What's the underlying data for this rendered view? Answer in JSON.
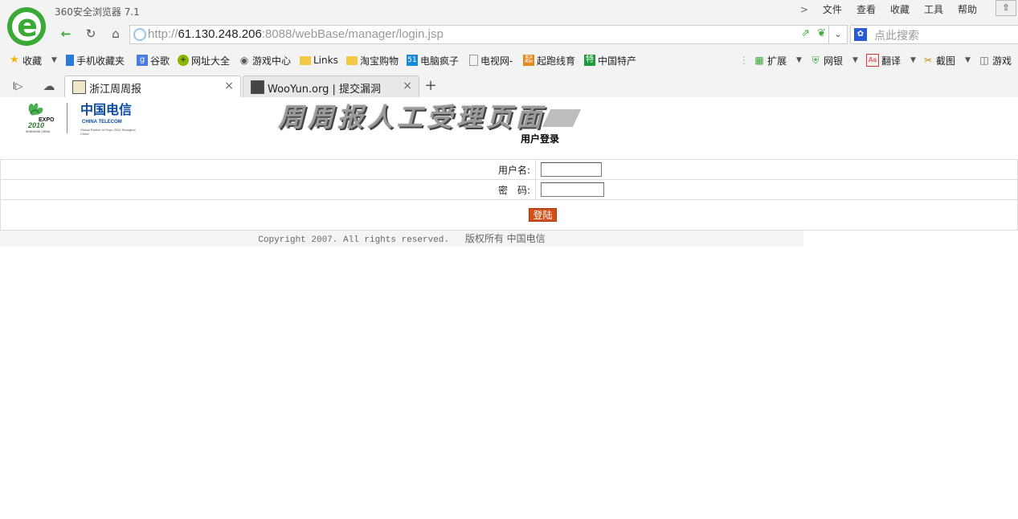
{
  "app": {
    "title": "360安全浏览器 7.1"
  },
  "menu": {
    "chevron": ">",
    "items": [
      "文件",
      "查看",
      "收藏",
      "工具",
      "帮助"
    ],
    "up": "⇧"
  },
  "toolbar": {
    "back": "←",
    "reload": "↻",
    "home": "⌂"
  },
  "address": {
    "url_prefix": "http://",
    "url_host": "61.130.248.206",
    "url_rest": ":8088/webBase/manager/login.jsp",
    "dropdown": "⌄"
  },
  "search": {
    "placeholder": "点此搜索"
  },
  "bookmarks": [
    {
      "label": "收藏",
      "icon": "star-icon"
    },
    {
      "label": "手机收藏夹",
      "icon": "phone-icon"
    },
    {
      "label": "谷歌",
      "icon": "google-icon"
    },
    {
      "label": "网址大全",
      "icon": "plus-icon"
    },
    {
      "label": "游戏中心",
      "icon": "gamepad-icon"
    },
    {
      "label": "Links",
      "icon": "folder-icon"
    },
    {
      "label": "淘宝购物",
      "icon": "folder-icon"
    },
    {
      "label": "电脑疯子",
      "icon": "51-icon",
      "badge": "51"
    },
    {
      "label": "电视网-",
      "icon": "page-icon"
    },
    {
      "label": "起跑线育",
      "icon": "qi-icon",
      "badge": "起"
    },
    {
      "label": "中国特产",
      "icon": "te-icon",
      "badge": "特"
    }
  ],
  "extensions": [
    {
      "label": "扩展",
      "icon": "grid-icon"
    },
    {
      "label": "网银",
      "icon": "shield-icon"
    },
    {
      "label": "翻译",
      "icon": "translate-icon",
      "badge": "Aa"
    },
    {
      "label": "截图",
      "icon": "scissors-icon"
    },
    {
      "label": "游戏",
      "icon": "game-icon"
    }
  ],
  "tabs": [
    {
      "label": "浙江周周报",
      "active": true
    },
    {
      "label": "WooYun.org | 提交漏洞",
      "active": false
    }
  ],
  "tab_controls": {
    "new_tab": "+",
    "close": "×",
    "sidebar": "I▷",
    "cloud": "☁"
  },
  "page": {
    "brand_cn": "中国电信",
    "brand_en": "CHINA TELECOM",
    "brand_sub": "Global Partner of Expo 2010 Shanghai China",
    "expo_text": "EXPO",
    "expo_year": "2010",
    "expo_sub": "SHANGHAI CHINA",
    "banner": "周周报人工受理页面",
    "login_title": "用户登录",
    "username_label": "用户名:",
    "password_label": "密　码:",
    "username_value": "",
    "password_value": "",
    "login_button": "登陆",
    "footer_copyright": "Copyright 2007. All rights reserved.",
    "footer_cn": "版权所有 中国电信"
  },
  "colors": {
    "accent_green": "#3aa935",
    "button_orange": "#d2501a",
    "brand_blue": "#0a4a9c"
  }
}
